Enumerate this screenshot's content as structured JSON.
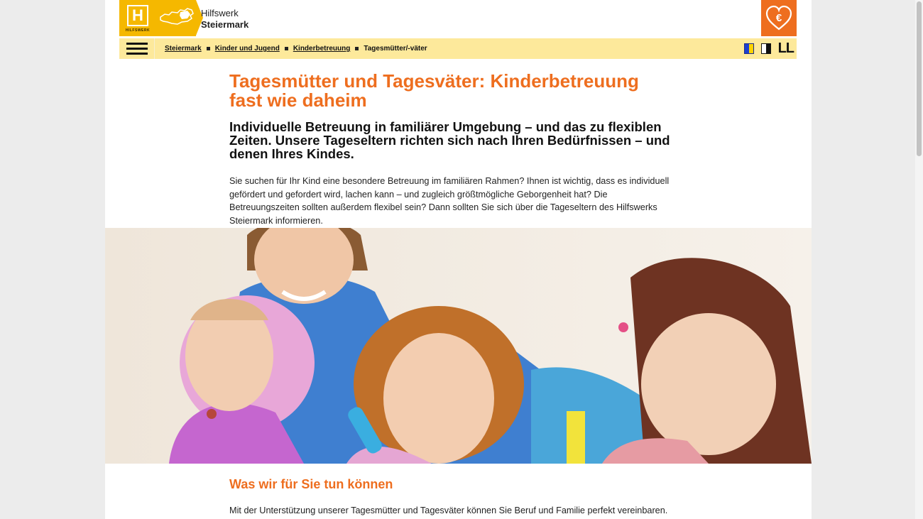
{
  "header": {
    "logo_small_text": "HILFSWERK",
    "brand_line1": "Hilfswerk",
    "brand_line2": "Steiermark",
    "logo_letter": "H"
  },
  "nav": {
    "breadcrumbs": [
      "Steiermark",
      "Kinder und Jugend",
      "Kinderbetreuung"
    ],
    "current": "Tagesmütter/-väter",
    "font_size_label": "LL"
  },
  "main": {
    "title": "Tagesmütter und Tagesväter: Kinderbetreuung fast wie daheim",
    "lead": "Individuelle Betreuung in familiärer Umgebung – und das zu flexiblen Zeiten. Unsere Tageseltern richten sich nach Ihren Bedürfnissen – und denen Ihres Kindes.",
    "intro": "Sie suchen für Ihr Kind eine besondere Betreuung im familiären Rahmen? Ihnen ist wichtig, dass es individuell gefördert und gefordert wird, lachen kann – und zugleich größtmögliche Geborgenheit hat? Die Betreuungszeiten sollten außerdem flexibel sein? Dann sollten Sie sich über die Tageseltern des Hilfswerks Steiermark informieren.",
    "section_title": "Was wir für Sie tun können",
    "section_text": "Mit der Unterstützung unserer Tagesmütter und Tagesväter können Sie Beruf und Familie perfekt vereinbaren."
  },
  "colors": {
    "accent_orange": "#ee6e1f",
    "logo_yellow": "#f5b800",
    "navbar_yellow": "#fde99b"
  },
  "icons": [
    "hamburger-menu-icon",
    "euro-heart-icon",
    "contrast-blue-yellow-icon",
    "contrast-black-white-icon",
    "austria-map-icon"
  ]
}
